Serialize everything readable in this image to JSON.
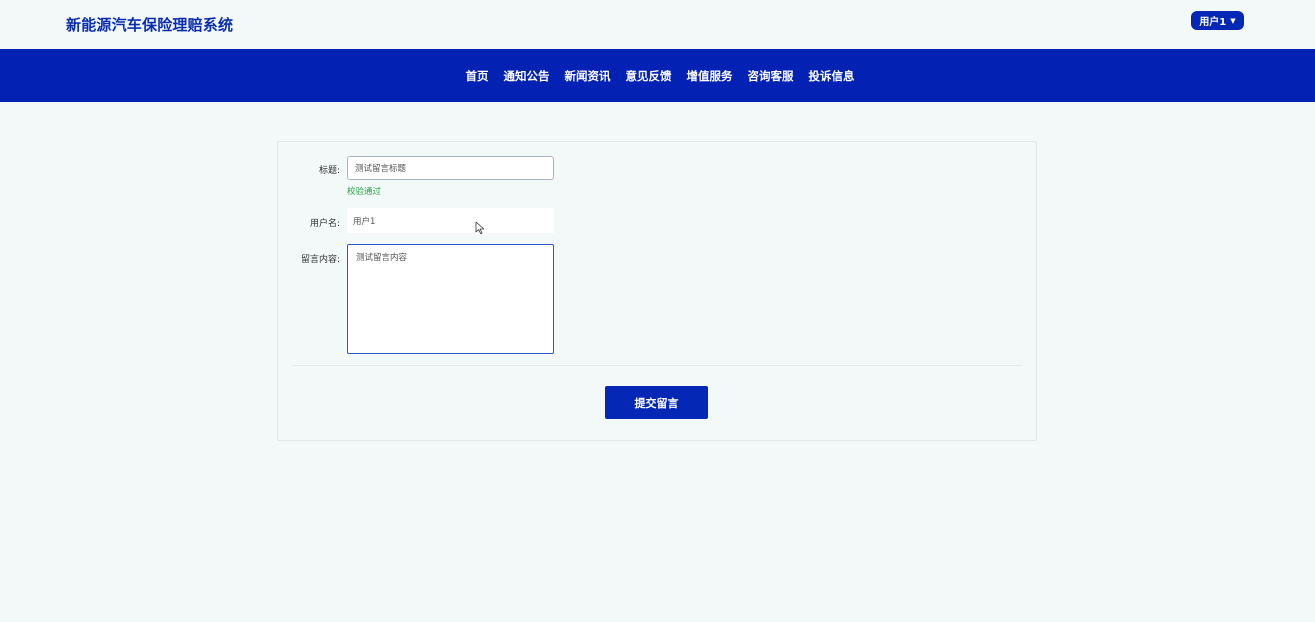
{
  "header": {
    "brand": "新能源汽车保险理赔系统",
    "user_menu_label": "用户1"
  },
  "nav": {
    "items": [
      "首页",
      "通知公告",
      "新闻资讯",
      "意见反馈",
      "增值服务",
      "咨询客服",
      "投诉信息"
    ]
  },
  "form": {
    "title_label": "标题:",
    "title_value": "测试留言标题",
    "title_hint": "校验通过",
    "username_label": "用户名:",
    "username_value": "用户1",
    "content_label": "留言内容:",
    "content_value": "测试留言内容",
    "submit_label": "提交留言"
  },
  "colors": {
    "primary": "#0322b3",
    "success": "#2aa246",
    "background": "#f3f8f8"
  },
  "icons": {
    "user_menu": "chevron-down-icon",
    "pointer": "mouse-pointer-icon"
  }
}
